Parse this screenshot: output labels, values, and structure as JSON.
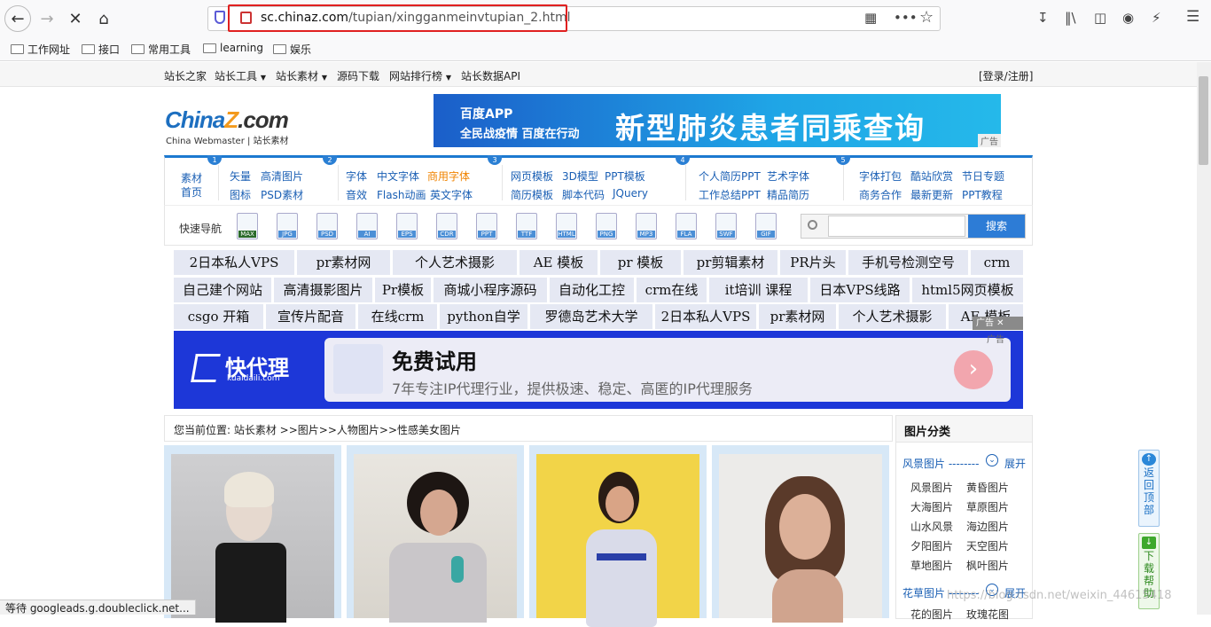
{
  "browser": {
    "url_domain": "sc.chinaz.com",
    "url_path": "/tupian/xingganmeinvtupian_2.html",
    "status": "等待 googleads.g.doubleclick.net...",
    "bookmarks": [
      "工作网址",
      "接口",
      "常用工具",
      "learning",
      "娱乐"
    ]
  },
  "topnav": {
    "items": [
      "站长之家",
      "站长工具",
      "站长素材",
      "源码下载",
      "网站排行榜",
      "站长数据API"
    ],
    "login": "[登录/注册]"
  },
  "logo": {
    "china": "China",
    "z": "Z",
    "com": ".com",
    "sub": "China Webmaster | 站长素材"
  },
  "banner": {
    "app": "百度APP",
    "sub": "全民战疫情 百度在行动",
    "main": "新型肺炎患者同乘查询",
    "ad": "广告"
  },
  "category": {
    "home": [
      "素材",
      "首页"
    ],
    "nums": [
      "1",
      "2",
      "3",
      "4",
      "5"
    ],
    "groups": [
      [
        [
          "矢量",
          "高清图片"
        ],
        [
          "图标",
          "PSD素材"
        ]
      ],
      [
        [
          "字体",
          "中文字体",
          "商用字体"
        ],
        [
          "音效",
          "Flash动画",
          "英文字体"
        ]
      ],
      [
        [
          "网页模板",
          "3D模型",
          "PPT模板"
        ],
        [
          "简历模板",
          "脚本代码",
          "JQuery"
        ]
      ],
      [
        [
          "个人简历PPT",
          "艺术字体"
        ],
        [
          "工作总结PPT",
          "精品简历"
        ]
      ],
      [
        [
          "字体打包",
          "酷站欣赏",
          "节日专题"
        ],
        [
          "商务合作",
          "最新更新",
          "PPT教程"
        ]
      ]
    ]
  },
  "quick": {
    "label": "快速导航",
    "icons": [
      "MAX",
      "JPG",
      "PSD",
      "AI",
      "EPS",
      "CDR",
      "PPT",
      "TTF",
      "HTML",
      "PNG",
      "MP3",
      "FLA",
      "SWF",
      "GIF"
    ],
    "search_button": "搜索"
  },
  "keywords": [
    [
      "2日本私人VPS",
      "pr素材网",
      "个人艺术摄影",
      "AE 模板",
      "pr 模板",
      "pr剪辑素材",
      "PR片头",
      "手机号检测空号",
      "crm"
    ],
    [
      "自己建个网站",
      "高清摄影图片",
      "Pr模板",
      "商城小程序源码",
      "自动化工控",
      "crm在线",
      "it培训 课程",
      "日本VPS线路",
      "html5网页模板"
    ],
    [
      "csgo 开箱",
      "宣传片配音",
      "在线crm",
      "python自学",
      "罗德岛艺术大学",
      "2日本私人VPS",
      "pr素材网",
      "个人艺术摄影",
      "AE 模板"
    ]
  ],
  "ad_close": "广告",
  "kuai": {
    "logo": "快代理",
    "domain": "kuaidaili.com",
    "title": "免费试用",
    "desc": "7年专注IP代理行业，提供极速、稳定、高匿的IP代理服务",
    "ad": "广告"
  },
  "breadcrumb": "您当前位置:  站长素材 >>图片>>人物图片>>性感美女图片",
  "sidebar": {
    "title": "图片分类",
    "section1": "风景图片 --------",
    "expand": "展开",
    "links": [
      "风景图片",
      "黄昏图片",
      "大海图片",
      "草原图片",
      "山水风景",
      "海边图片",
      "夕阳图片",
      "天空图片",
      "草地图片",
      "枫叶图片"
    ],
    "section2": "花草图片 --------",
    "more": [
      "花的图片",
      "玫瑰花图"
    ]
  },
  "floating": {
    "top": "返回顶部",
    "download": "下载帮助"
  },
  "watermark": "https://blog.csdn.net/weixin_44615418"
}
